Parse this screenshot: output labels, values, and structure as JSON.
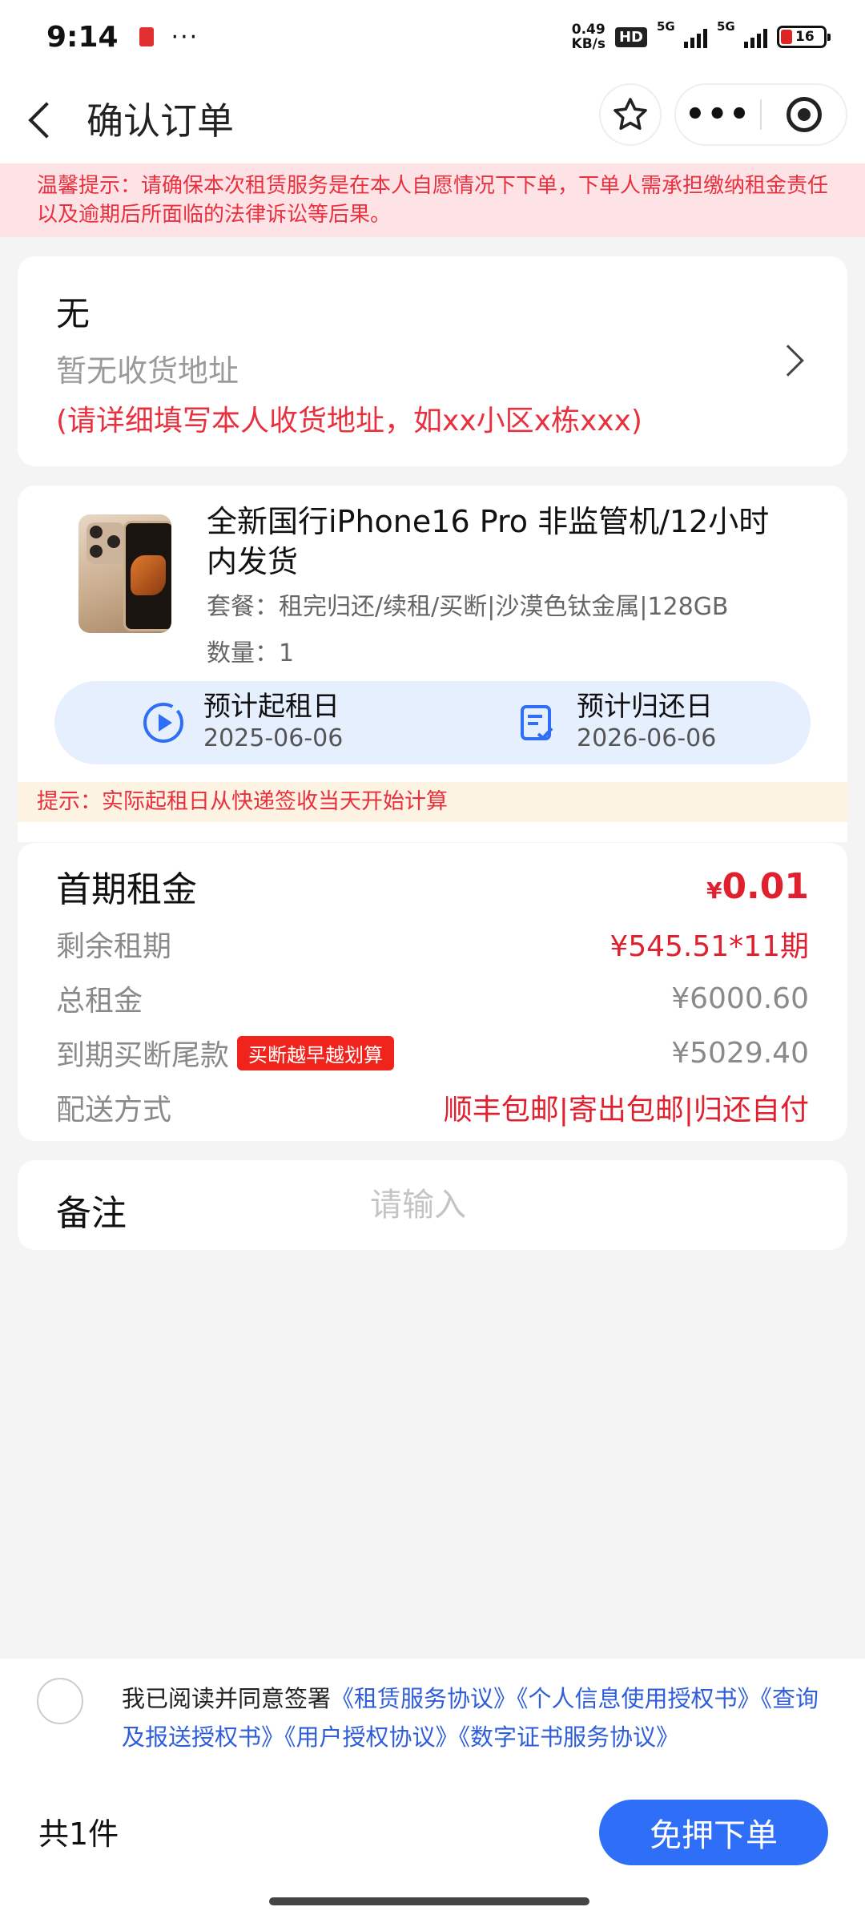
{
  "status_bar": {
    "time": "9:14",
    "more": "···",
    "net_speed_value": "0.49",
    "net_speed_unit": "KB/s",
    "hd": "HD",
    "sig1": "5G",
    "sig2": "5G",
    "battery": "16"
  },
  "nav": {
    "title": "确认订单",
    "more": "•••"
  },
  "warning": "温馨提示：请确保本次租赁服务是在本人自愿情况下下单，下单人需承担缴纳租金责任以及逾期后所面临的法律诉讼等后果。",
  "address": {
    "name": "无",
    "empty": "暂无收货地址",
    "hint": "(请详细填写本人收货地址，如xx小区x栋xxx)"
  },
  "product": {
    "title": "全新国行iPhone16 Pro 非监管机/12小时内发货",
    "package": "套餐：租完归还/续租/买断|沙漠色钛金属|128GB",
    "quantity": "数量：1",
    "start_label": "预计起租日",
    "start_date": "2025-06-06",
    "return_label": "预计归还日",
    "return_date": "2026-06-06"
  },
  "tip": "提示：实际起租日从快递签收当天开始计算",
  "rent": {
    "first_label": "首期租金",
    "first_currency": "¥",
    "first_value": "0.01",
    "remaining_label": "剩余租期",
    "remaining_value": "¥545.51*11期",
    "total_label": "总租金",
    "total_value": "¥6000.60",
    "buyout_label": "到期买断尾款",
    "buyout_badge": "买断越早越划算",
    "buyout_value": "¥5029.40",
    "delivery_label": "配送方式",
    "delivery_value": "顺丰包邮|寄出包邮|归还自付"
  },
  "memo": {
    "label": "备注",
    "placeholder": "请输入",
    "value": ""
  },
  "agreement": {
    "prefix": "我已阅读并同意签署",
    "links": [
      "《租赁服务协议》",
      "《个人信息使用授权书》",
      "《查询及报送授权书》",
      "《用户授权协议》",
      "《数字证书服务协议》"
    ]
  },
  "footer": {
    "count": "共1件",
    "submit": "免押下单"
  },
  "colors": {
    "accent_blue": "#2f6ef6",
    "price_red": "#e0202e",
    "link_blue": "#2f5ed8"
  }
}
